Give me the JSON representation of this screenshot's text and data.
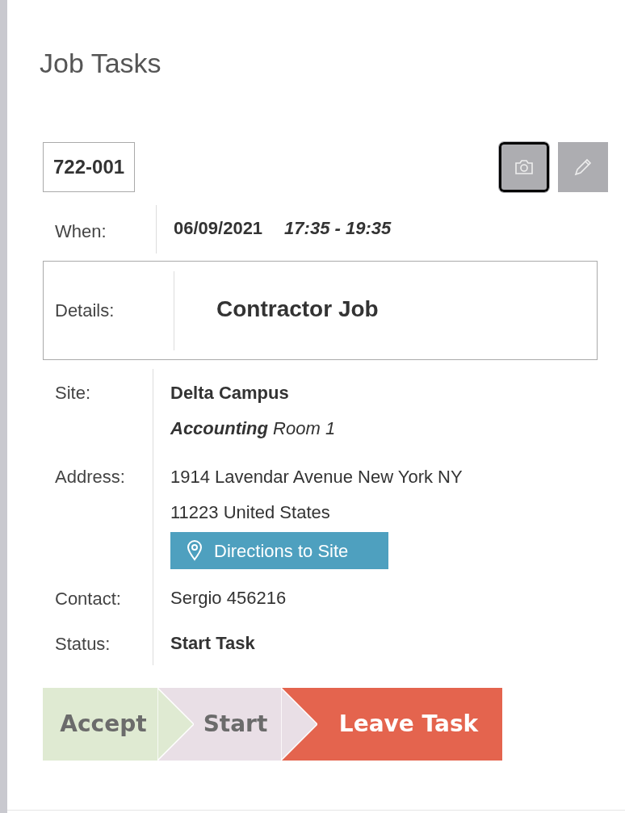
{
  "title": "Job Tasks",
  "job_number": "722-001",
  "toolbar": [
    {
      "kind": "camera",
      "focused": true
    },
    {
      "kind": "edit",
      "focused": false
    }
  ],
  "when": {
    "label": "When:",
    "date": "06/09/2021",
    "time": "17:35 - 19:35"
  },
  "details": {
    "label": "Details:",
    "value": "Contractor Job"
  },
  "site": {
    "label": "Site:",
    "name": "Delta Campus",
    "room": "**Accounting** Room 1"
  },
  "address": {
    "label": "Address:",
    "value": "1914 Lavendar Avenue New York NY 11223 United States",
    "directions_button": "Directions to Site"
  },
  "contact": {
    "label": "Contact:",
    "value": "Sergio 456216"
  },
  "status": {
    "label": "Status:",
    "value": "Start Task"
  },
  "steps": [
    {
      "label": "Accept",
      "color": "#dfead2"
    },
    {
      "label": "Start",
      "color": "#e9dfe6"
    },
    {
      "label": "Leave Task",
      "color": "#e4644e"
    }
  ]
}
